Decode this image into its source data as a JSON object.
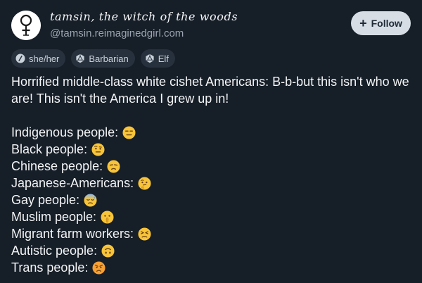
{
  "author": {
    "display_name": "tamsin, the witch of the woods",
    "handle": "@tamsin.reimaginedgirl.com"
  },
  "follow_button": {
    "label": "Follow",
    "icon": "plus-icon"
  },
  "badges": [
    {
      "label": "she/her",
      "icon": "pronoun-icon"
    },
    {
      "label": "Barbarian",
      "icon": "d20-icon"
    },
    {
      "label": "Elf",
      "icon": "d20-icon"
    }
  ],
  "post": {
    "intro": "Horrified middle-class white cishet Americans: B-b-but this isn't who we are! This isn't the America I grew up in!",
    "lines": [
      {
        "text": "Indigenous people:",
        "emoji": "expressionless-face"
      },
      {
        "text": "Black people:",
        "emoji": "raised-eyebrow-face"
      },
      {
        "text": "Chinese people:",
        "emoji": "unamused-face"
      },
      {
        "text": "Japanese-Americans:",
        "emoji": "thinking-face"
      },
      {
        "text": "Gay people:",
        "emoji": "downcast-sweat-face"
      },
      {
        "text": "Muslim people:",
        "emoji": "shushing-face"
      },
      {
        "text": "Migrant farm workers:",
        "emoji": "persevering-face"
      },
      {
        "text": "Autistic people:",
        "emoji": "upside-down-face"
      },
      {
        "text": "Trans people:",
        "emoji": "angry-face"
      }
    ]
  },
  "colors": {
    "background": "#161e27",
    "badge_bg": "#27313d",
    "follow_bg": "#d6dde5",
    "emoji_yellow": "#f7c43a"
  }
}
